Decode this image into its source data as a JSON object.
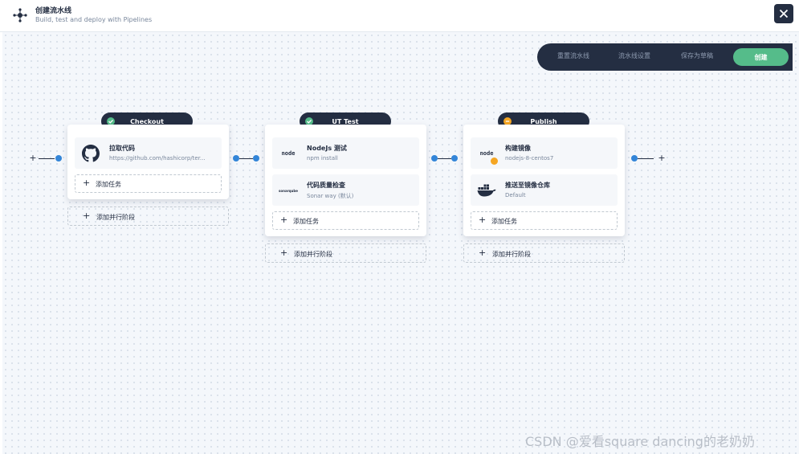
{
  "header": {
    "title": "创建流水线",
    "subtitle": "Build, test and deploy with Pipelines",
    "close": "×"
  },
  "toolbar": {
    "reset": "重置流水线",
    "settings": "流水线设置",
    "save_draft": "保存为草稿",
    "create": "创建"
  },
  "stages": [
    {
      "name": "Checkout",
      "status": "success",
      "tasks": [
        {
          "name": "拉取代码",
          "desc": "https://github.com/hashicorp/ter...",
          "icon": "github-icon"
        }
      ],
      "add_task": "添加任务",
      "add_parallel": "添加并行阶段"
    },
    {
      "name": "UT Test",
      "status": "success",
      "tasks": [
        {
          "name": "NodeJs 测试",
          "desc": "npm install",
          "icon": "nodejs-icon"
        },
        {
          "name": "代码质量检查",
          "desc": "Sonar way (默认)",
          "icon": "sonarqube-icon"
        }
      ],
      "add_task": "添加任务",
      "add_parallel": "添加并行阶段"
    },
    {
      "name": "Publish",
      "status": "warning",
      "tasks": [
        {
          "name": "构建镜像",
          "desc": "nodejs-8-centos7",
          "icon": "nodejs-icon"
        },
        {
          "name": "推送至镜像仓库",
          "desc": "Default",
          "icon": "docker-icon"
        }
      ],
      "add_task": "添加任务",
      "add_parallel": "添加并行阶段"
    }
  ],
  "plus_glyph": "+",
  "icon_text": {
    "node": "node",
    "sonar": "sonarqube"
  },
  "watermark": "CSDN @爱看square dancing的老奶奶",
  "colors": {
    "dark": "#242e42",
    "success": "#55bc8a",
    "warning": "#f5a623",
    "connector": "#3385d8"
  }
}
